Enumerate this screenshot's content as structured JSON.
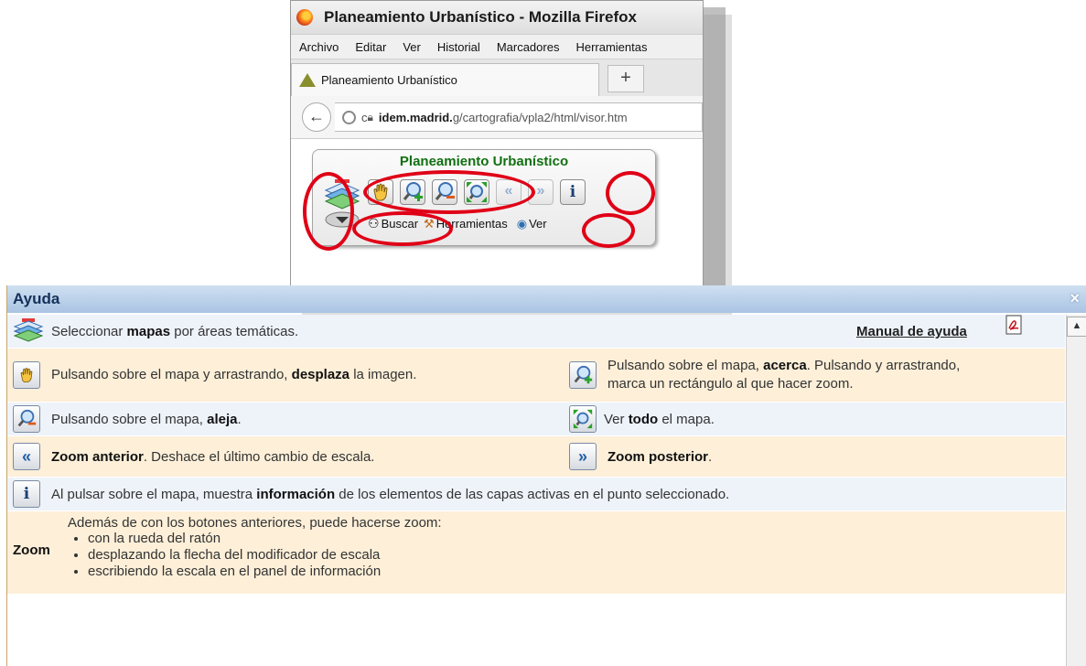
{
  "browser": {
    "title": "Planeamiento Urbanístico - Mozilla Firefox",
    "menu": [
      "Archivo",
      "Editar",
      "Ver",
      "Historial",
      "Marcadores",
      "Herramientas"
    ],
    "tab_label": "Planeamiento Urbanístico",
    "new_tab": "+",
    "url_prefix": "c",
    "url_domain": "idem.madrid.",
    "url_path": "g/cartografia/vpla2/html/visor.htm"
  },
  "toolbar": {
    "title": "Planeamiento Urbanístico",
    "links": [
      "Buscar",
      "Herramientas",
      "Ver"
    ],
    "info_glyph": "i",
    "prev_glyph": "«",
    "next_glyph": "»"
  },
  "help": {
    "title": "Ayuda",
    "close": "×",
    "manual": "Manual de ayuda",
    "rows": {
      "maps_pre": "Seleccionar ",
      "maps_bold": "mapas",
      "maps_post": " por áreas temáticas.",
      "pan_pre": "Pulsando sobre el mapa y arrastrando, ",
      "pan_bold": "desplaza",
      "pan_post": " la imagen.",
      "zoomin_pre": "Pulsando sobre el mapa, ",
      "zoomin_bold": "acerca",
      "zoomin_post": ". Pulsando y arrastrando, marca un rectángulo al que hacer zoom.",
      "zoomout_pre": "Pulsando sobre el mapa, ",
      "zoomout_bold": "aleja",
      "zoomout_post": ".",
      "all_pre": "Ver ",
      "all_bold": "todo",
      "all_post": " el mapa.",
      "prev_bold": "Zoom anterior",
      "prev_post": ". Deshace el último cambio de escala.",
      "next_bold": "Zoom posterior",
      "next_post": ".",
      "info_pre": "Al pulsar sobre el mapa, muestra ",
      "info_bold": "información",
      "info_post": " de los elementos de las capas activas en el punto seleccionado.",
      "zoom_label": "Zoom",
      "zoom_intro": "Además de con los botones anteriores, puede hacerse zoom:",
      "zoom_items": [
        "con la rueda del ratón",
        "desplazando la flecha del modificador de escala",
        "escribiendo la escala en el panel de información"
      ]
    }
  },
  "colors": {
    "highlight": "#e00016",
    "title_green": "#117011",
    "cream_row": "#fdefd8",
    "blue_row": "#eef3fa"
  },
  "icons": [
    "firefox-logo-icon",
    "back-arrow-icon",
    "globe-icon",
    "lock-icon",
    "layers-icon",
    "hand-pan-icon",
    "zoom-in-icon",
    "zoom-out-icon",
    "zoom-all-icon",
    "prev-icon",
    "next-icon",
    "info-icon",
    "binoculars-icon",
    "tools-icon",
    "eye-icon",
    "pdf-icon"
  ]
}
